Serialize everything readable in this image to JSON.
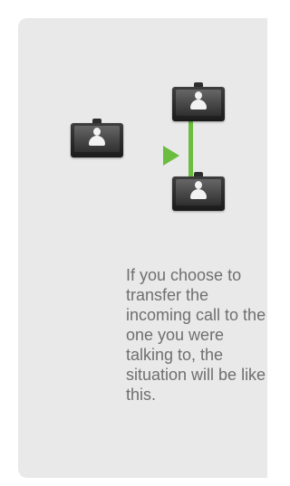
{
  "illustration": {
    "devices": [
      {
        "icon": "video-endpoint-icon",
        "role": "caller"
      },
      {
        "icon": "video-endpoint-icon",
        "role": "incoming-call"
      },
      {
        "icon": "video-endpoint-icon",
        "role": "current-call"
      }
    ],
    "arrow_icon": "play-arrow-icon",
    "accent_color": "#6abd3f"
  },
  "description": "If you choose to transfer the incoming call to the one you were talking to, the situation will be like this."
}
